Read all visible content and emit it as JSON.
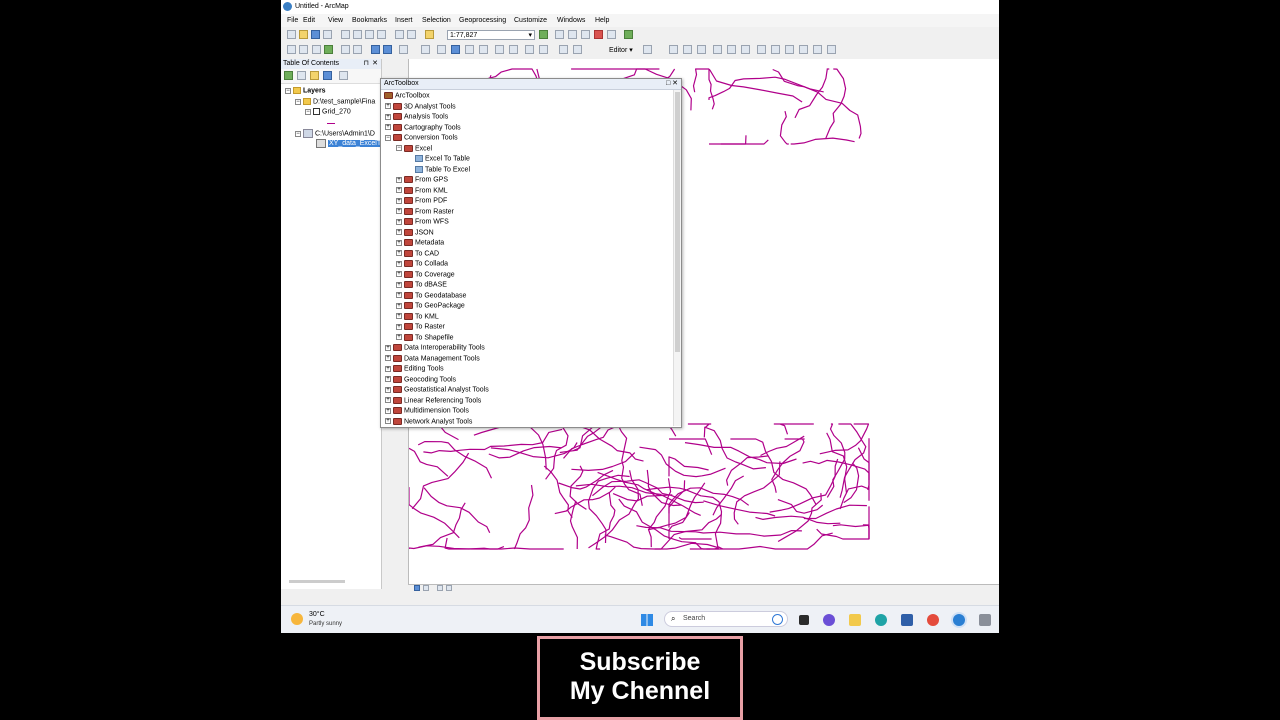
{
  "window": {
    "title": "Untitled - ArcMap"
  },
  "menu": [
    "File",
    "Edit",
    "View",
    "Bookmarks",
    "Insert",
    "Selection",
    "Geoprocessing",
    "Customize",
    "Windows",
    "Help"
  ],
  "toolbar": {
    "scale_value": "1:77,827",
    "editor_label": "Editor ▾"
  },
  "toc": {
    "title": "Table Of Contents",
    "layers_label": "Layers",
    "folder1": "D:\\test_sample\\Fina",
    "layer_grid": "Grid_270",
    "folder2": "C:\\Users\\Admin1\\D",
    "selected_table": "XY_data_ExcelTo"
  },
  "arctoolbox": {
    "title": "ArcToolbox",
    "root": "ArcToolbox",
    "items": [
      {
        "label": "3D Analyst Tools",
        "level": 1,
        "type": "toolbox",
        "exp": "+"
      },
      {
        "label": "Analysis Tools",
        "level": 1,
        "type": "toolbox",
        "exp": "+"
      },
      {
        "label": "Cartography Tools",
        "level": 1,
        "type": "toolbox",
        "exp": "+"
      },
      {
        "label": "Conversion Tools",
        "level": 1,
        "type": "toolbox",
        "exp": "−"
      },
      {
        "label": "Excel",
        "level": 2,
        "type": "toolbox",
        "exp": "−"
      },
      {
        "label": "Excel To Table",
        "level": 3,
        "type": "tool",
        "exp": ""
      },
      {
        "label": "Table To Excel",
        "level": 3,
        "type": "tool",
        "exp": ""
      },
      {
        "label": "From GPS",
        "level": 2,
        "type": "toolbox",
        "exp": "+"
      },
      {
        "label": "From KML",
        "level": 2,
        "type": "toolbox",
        "exp": "+"
      },
      {
        "label": "From PDF",
        "level": 2,
        "type": "toolbox",
        "exp": "+"
      },
      {
        "label": "From Raster",
        "level": 2,
        "type": "toolbox",
        "exp": "+"
      },
      {
        "label": "From WFS",
        "level": 2,
        "type": "toolbox",
        "exp": "+"
      },
      {
        "label": "JSON",
        "level": 2,
        "type": "toolbox",
        "exp": "+"
      },
      {
        "label": "Metadata",
        "level": 2,
        "type": "toolbox",
        "exp": "+"
      },
      {
        "label": "To CAD",
        "level": 2,
        "type": "toolbox",
        "exp": "+"
      },
      {
        "label": "To Collada",
        "level": 2,
        "type": "toolbox",
        "exp": "+"
      },
      {
        "label": "To Coverage",
        "level": 2,
        "type": "toolbox",
        "exp": "+"
      },
      {
        "label": "To dBASE",
        "level": 2,
        "type": "toolbox",
        "exp": "+"
      },
      {
        "label": "To Geodatabase",
        "level": 2,
        "type": "toolbox",
        "exp": "+"
      },
      {
        "label": "To GeoPackage",
        "level": 2,
        "type": "toolbox",
        "exp": "+"
      },
      {
        "label": "To KML",
        "level": 2,
        "type": "toolbox",
        "exp": "+"
      },
      {
        "label": "To Raster",
        "level": 2,
        "type": "toolbox",
        "exp": "+"
      },
      {
        "label": "To Shapefile",
        "level": 2,
        "type": "toolbox",
        "exp": "+"
      },
      {
        "label": "Data Interoperability Tools",
        "level": 1,
        "type": "toolbox",
        "exp": "+"
      },
      {
        "label": "Data Management Tools",
        "level": 1,
        "type": "toolbox",
        "exp": "+"
      },
      {
        "label": "Editing Tools",
        "level": 1,
        "type": "toolbox",
        "exp": "+"
      },
      {
        "label": "Geocoding Tools",
        "level": 1,
        "type": "toolbox",
        "exp": "+"
      },
      {
        "label": "Geostatistical Analyst Tools",
        "level": 1,
        "type": "toolbox",
        "exp": "+"
      },
      {
        "label": "Linear Referencing Tools",
        "level": 1,
        "type": "toolbox",
        "exp": "+"
      },
      {
        "label": "Multidimension Tools",
        "level": 1,
        "type": "toolbox",
        "exp": "+"
      },
      {
        "label": "Network Analyst Tools",
        "level": 1,
        "type": "toolbox",
        "exp": "+"
      }
    ]
  },
  "map": {
    "line_color": "#b0008a"
  },
  "taskbar": {
    "temperature": "30°C",
    "weather": "Partly sunny",
    "search_placeholder": "Search"
  },
  "overlay": {
    "line1": "Subscribe",
    "line2": "My Chennel"
  }
}
